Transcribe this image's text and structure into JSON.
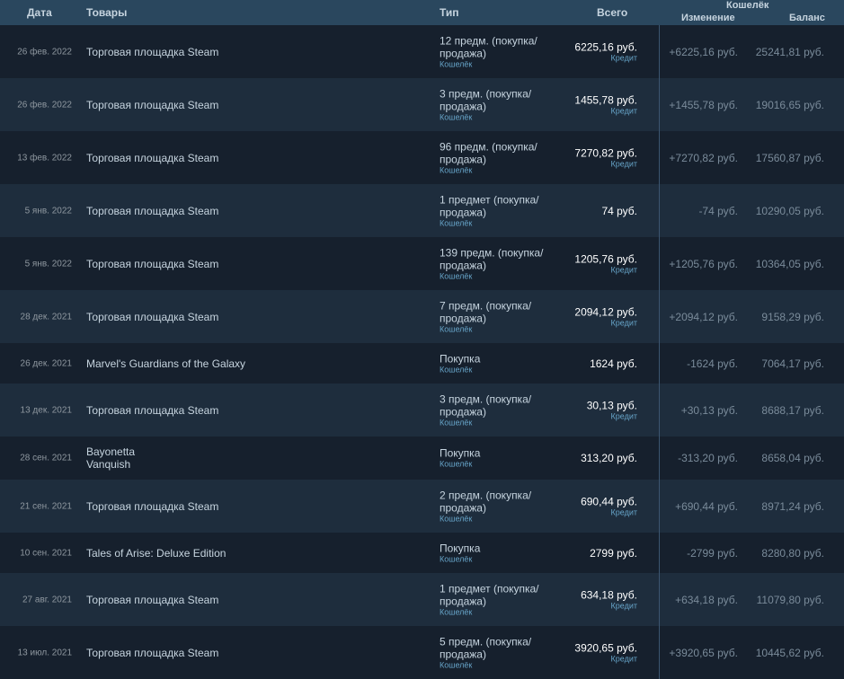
{
  "header": {
    "date": "Дата",
    "items": "Товары",
    "type": "Тип",
    "total": "Всего",
    "wallet": "Кошелёк",
    "change": "Изменение",
    "balance": "Баланс"
  },
  "rows": [
    {
      "date": "26 фев. 2022",
      "items": [
        "Торговая площадка Steam"
      ],
      "type": "12 предм. (покупка/ продажа)",
      "type_sub": "Кошелёк",
      "total": "6225,16 руб.",
      "total_sub": "Кредит",
      "change": "+6225,16 руб.",
      "balance": "25241,81 руб."
    },
    {
      "date": "26 фев. 2022",
      "items": [
        "Торговая площадка Steam"
      ],
      "type": "3 предм. (покупка/ продажа)",
      "type_sub": "Кошелёк",
      "total": "1455,78 руб.",
      "total_sub": "Кредит",
      "change": "+1455,78 руб.",
      "balance": "19016,65 руб."
    },
    {
      "date": "13 фев. 2022",
      "items": [
        "Торговая площадка Steam"
      ],
      "type": "96 предм. (покупка/ продажа)",
      "type_sub": "Кошелёк",
      "total": "7270,82 руб.",
      "total_sub": "Кредит",
      "change": "+7270,82 руб.",
      "balance": "17560,87 руб."
    },
    {
      "date": "5 янв. 2022",
      "items": [
        "Торговая площадка Steam"
      ],
      "type": "1 предмет (покупка/ продажа)",
      "type_sub": "Кошелёк",
      "total": "74 руб.",
      "total_sub": "",
      "change": "-74 руб.",
      "balance": "10290,05 руб."
    },
    {
      "date": "5 янв. 2022",
      "items": [
        "Торговая площадка Steam"
      ],
      "type": "139 предм. (покупка/ продажа)",
      "type_sub": "Кошелёк",
      "total": "1205,76 руб.",
      "total_sub": "Кредит",
      "change": "+1205,76 руб.",
      "balance": "10364,05 руб."
    },
    {
      "date": "28 дек. 2021",
      "items": [
        "Торговая площадка Steam"
      ],
      "type": "7 предм. (покупка/ продажа)",
      "type_sub": "Кошелёк",
      "total": "2094,12 руб.",
      "total_sub": "Кредит",
      "change": "+2094,12 руб.",
      "balance": "9158,29 руб."
    },
    {
      "date": "26 дек. 2021",
      "items": [
        "Marvel's Guardians of the Galaxy"
      ],
      "type": "Покупка",
      "type_sub": "Кошелёк",
      "total": "1624 руб.",
      "total_sub": "",
      "change": "-1624 руб.",
      "balance": "7064,17 руб.",
      "short": true
    },
    {
      "date": "13 дек. 2021",
      "items": [
        "Торговая площадка Steam"
      ],
      "type": "3 предм. (покупка/ продажа)",
      "type_sub": "Кошелёк",
      "total": "30,13 руб.",
      "total_sub": "Кредит",
      "change": "+30,13 руб.",
      "balance": "8688,17 руб."
    },
    {
      "date": "28 сен. 2021",
      "items": [
        "Bayonetta",
        "Vanquish"
      ],
      "type": "Покупка",
      "type_sub": "Кошелёк",
      "total": "313,20 руб.",
      "total_sub": "",
      "change": "-313,20 руб.",
      "balance": "8658,04 руб.",
      "short": true
    },
    {
      "date": "21 сен. 2021",
      "items": [
        "Торговая площадка Steam"
      ],
      "type": "2 предм. (покупка/ продажа)",
      "type_sub": "Кошелёк",
      "total": "690,44 руб.",
      "total_sub": "Кредит",
      "change": "+690,44 руб.",
      "balance": "8971,24 руб."
    },
    {
      "date": "10 сен. 2021",
      "items": [
        "Tales of Arise: Deluxe Edition"
      ],
      "type": "Покупка",
      "type_sub": "Кошелёк",
      "total": "2799 руб.",
      "total_sub": "",
      "change": "-2799 руб.",
      "balance": "8280,80 руб.",
      "short": true
    },
    {
      "date": "27 авг. 2021",
      "items": [
        "Торговая площадка Steam"
      ],
      "type": "1 предмет (покупка/ продажа)",
      "type_sub": "Кошелёк",
      "total": "634,18 руб.",
      "total_sub": "Кредит",
      "change": "+634,18 руб.",
      "balance": "11079,80 руб."
    },
    {
      "date": "13 июл. 2021",
      "items": [
        "Торговая площадка Steam"
      ],
      "type": "5 предм. (покупка/ продажа)",
      "type_sub": "Кошелёк",
      "total": "3920,65 руб.",
      "total_sub": "Кредит",
      "change": "+3920,65 руб.",
      "balance": "10445,62 руб."
    }
  ]
}
